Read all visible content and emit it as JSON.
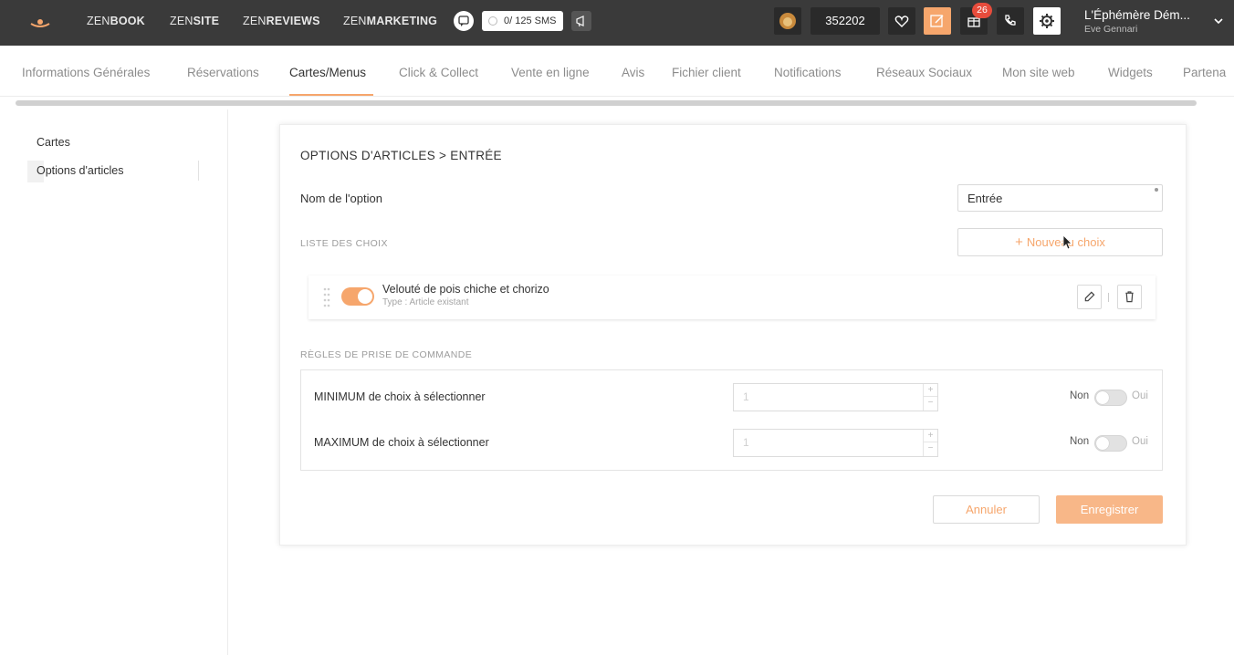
{
  "topbar": {
    "products": [
      {
        "prefix": "ZEN",
        "name": "BOOK"
      },
      {
        "prefix": "ZEN",
        "name": "SITE"
      },
      {
        "prefix": "ZEN",
        "name": "REVIEWS"
      },
      {
        "prefix": "ZEN",
        "name": "MARKETING"
      }
    ],
    "sms_counter": "0/ 125 SMS",
    "account_code": "352202",
    "notification_badge": "26",
    "account_name": "L'Éphémère Dém...",
    "account_user": "Eve Gennari",
    "icons": [
      "logo-icon",
      "chat-icon",
      "megaphone-icon",
      "lion-icon",
      "heart-icon",
      "edit-icon",
      "gift-icon",
      "phone-icon",
      "gear-icon",
      "chevron-down-icon"
    ],
    "accent_color": "#f6a66c"
  },
  "tabs": [
    {
      "label": "Informations Générales",
      "active": false
    },
    {
      "label": "Réservations",
      "active": false
    },
    {
      "label": "Cartes/Menus",
      "active": true
    },
    {
      "label": "Click & Collect",
      "active": false
    },
    {
      "label": "Vente en ligne",
      "active": false
    },
    {
      "label": "Avis",
      "active": false
    },
    {
      "label": "Fichier client",
      "active": false
    },
    {
      "label": "Notifications",
      "active": false
    },
    {
      "label": "Réseaux Sociaux",
      "active": false
    },
    {
      "label": "Mon site web",
      "active": false
    },
    {
      "label": "Widgets",
      "active": false
    },
    {
      "label": "Partena",
      "active": false
    }
  ],
  "sidebar": {
    "items": [
      {
        "label": "Cartes",
        "active": false
      },
      {
        "label": "Options d'articles",
        "active": true
      }
    ]
  },
  "form": {
    "breadcrumb": "OPTIONS D'ARTICLES > ENTRÉE",
    "option_name_label": "Nom de l'option",
    "option_name_value": "Entrée",
    "choices_section": "LISTE DES CHOIX",
    "new_choice_label": "Nouveau choix",
    "choices": [
      {
        "title": "Velouté de pois chiche et chorizo",
        "type": "Type : Article existant",
        "enabled": true
      }
    ],
    "rules_section": "RÈGLES DE PRISE DE COMMANDE",
    "rules": [
      {
        "label": "MINIMUM de choix à sélectionner",
        "value": "1",
        "toggle_no": "Non",
        "toggle_yes": "Oui",
        "enabled": false
      },
      {
        "label": "MAXIMUM de choix à sélectionner",
        "value": "1",
        "toggle_no": "Non",
        "toggle_yes": "Oui",
        "enabled": false
      }
    ],
    "cancel_label": "Annuler",
    "save_label": "Enregistrer"
  }
}
